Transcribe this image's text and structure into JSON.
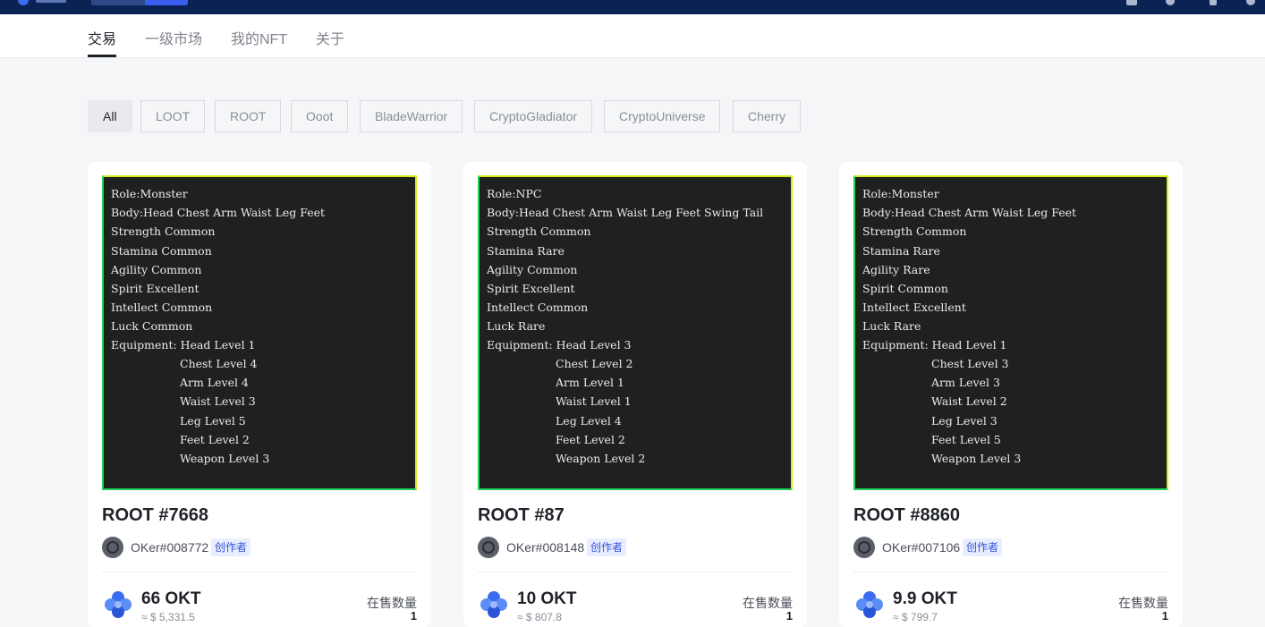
{
  "nav": {
    "tabs": [
      {
        "label": "交易",
        "active": true
      },
      {
        "label": "一级市场",
        "active": false
      },
      {
        "label": "我的NFT",
        "active": false
      },
      {
        "label": "关于",
        "active": false
      }
    ]
  },
  "filters": [
    "All",
    "LOOT",
    "ROOT",
    "Ooot",
    "BladeWarrior",
    "CryptoGladiator",
    "CryptoUniverse",
    "Cherry"
  ],
  "active_filter": "All",
  "colors": {
    "topbar": "#0b2354",
    "badge_bg": "#e8eeff",
    "badge_text": "#3250d8",
    "okt_blue": "#3b6cf0"
  },
  "icons": {
    "okt": "okt-coin-icon",
    "avatar": "avatar-icon"
  },
  "cards": [
    {
      "nft_lines": [
        "Role:Monster",
        "Body:Head Chest Arm Waist Leg Feet",
        "Strength Common",
        "Stamina Common",
        "Agility Common",
        "Spirit Excellent",
        "Intellect Common",
        "Luck Common",
        "Equipment: Head Level 1"
      ],
      "equip_lines": [
        "Chest Level 4",
        "Arm Level 4",
        "Waist Level 3",
        "Leg Level 5",
        "Feet Level 2",
        "Weapon Level 3"
      ],
      "title": "ROOT #7668",
      "creator": "OKer#008772",
      "badge": "创作者",
      "price": "66 OKT",
      "usd": "≈ $ 5,331.5",
      "qty_label": "在售数量",
      "qty": "1"
    },
    {
      "nft_lines": [
        "Role:NPC",
        "Body:Head Chest Arm Waist Leg Feet Swing Tail",
        "Strength Common",
        "Stamina Rare",
        "Agility Common",
        "Spirit Excellent",
        "Intellect Common",
        "Luck Rare",
        "Equipment: Head Level 3"
      ],
      "equip_lines": [
        "Chest Level 2",
        "Arm Level 1",
        "Waist Level 1",
        "Leg Level 4",
        "Feet Level 2",
        "Weapon Level 2"
      ],
      "title": "ROOT #87",
      "creator": "OKer#008148",
      "badge": "创作者",
      "price": "10 OKT",
      "usd": "≈ $ 807.8",
      "qty_label": "在售数量",
      "qty": "1"
    },
    {
      "nft_lines": [
        "Role:Monster",
        "Body:Head Chest Arm Waist Leg Feet",
        "Strength Common",
        "Stamina Rare",
        "Agility Rare",
        "Spirit Common",
        "Intellect Excellent",
        "Luck Rare",
        "Equipment: Head Level 1"
      ],
      "equip_lines": [
        "Chest Level 3",
        "Arm Level 3",
        "Waist Level 2",
        "Leg Level 3",
        "Feet Level 5",
        "Weapon Level 3"
      ],
      "title": "ROOT #8860",
      "creator": "OKer#007106",
      "badge": "创作者",
      "price": "9.9 OKT",
      "usd": "≈ $ 799.7",
      "qty_label": "在售数量",
      "qty": "1"
    }
  ]
}
